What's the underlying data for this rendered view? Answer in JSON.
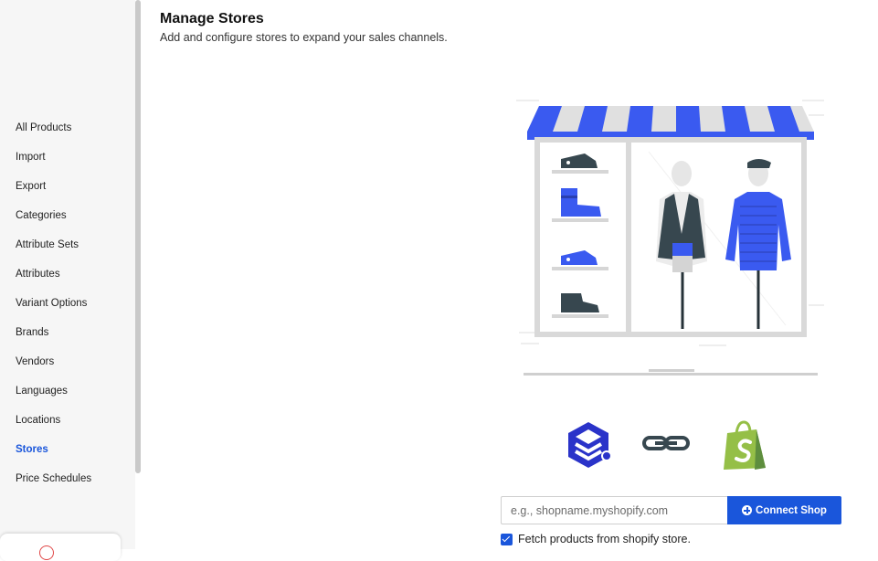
{
  "sidebar": {
    "items": [
      {
        "label": "All Products",
        "active": false
      },
      {
        "label": "Import",
        "active": false
      },
      {
        "label": "Export",
        "active": false
      },
      {
        "label": "Categories",
        "active": false
      },
      {
        "label": "Attribute Sets",
        "active": false
      },
      {
        "label": "Attributes",
        "active": false
      },
      {
        "label": "Variant Options",
        "active": false
      },
      {
        "label": "Brands",
        "active": false
      },
      {
        "label": "Vendors",
        "active": false
      },
      {
        "label": "Languages",
        "active": false
      },
      {
        "label": "Locations",
        "active": false
      },
      {
        "label": "Stores",
        "active": true
      },
      {
        "label": "Price Schedules",
        "active": false
      }
    ]
  },
  "header": {
    "title": "Manage Stores",
    "subtitle": "Add and configure stores to expand your sales channels."
  },
  "illustration": {
    "icon": "storefront-illustration"
  },
  "logos": {
    "left_icon": "app-logo-icon",
    "middle_icon": "link-icon",
    "right_icon": "shopify-logo-icon"
  },
  "connect": {
    "placeholder": "e.g., shopname.myshopify.com",
    "value": "",
    "button_label": "Connect Shop"
  },
  "fetch": {
    "checked": true,
    "label": "Fetch products from shopify store."
  },
  "colors": {
    "accent": "#1a56db",
    "shopify_green": "#95bf47",
    "awning_blue": "#3a5af0"
  }
}
